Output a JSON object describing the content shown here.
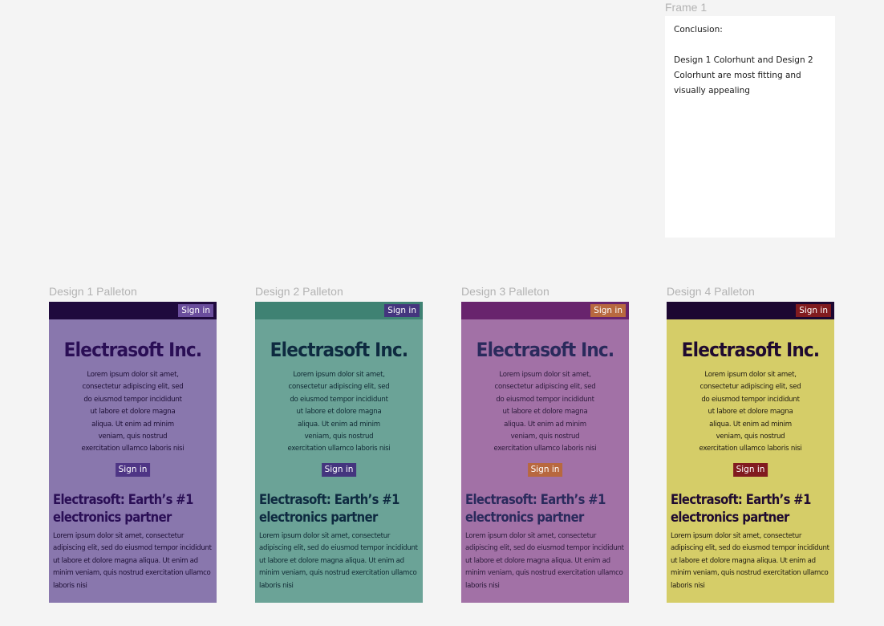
{
  "frame1": {
    "label": "Frame 1",
    "conclusion_heading": "Conclusion:",
    "conclusion_text": "Design 1 Colorhunt and  Design 2 Colorhunt are most fitting and visually appealing"
  },
  "designs": [
    {
      "label": "Design 1 Palleton",
      "topbar_signin": "Sign in",
      "hero_title": "Electrasoft Inc.",
      "hero_body": "Lorem ipsum dolor sit amet, consectetur adipiscing elit, sed do eiusmod tempor incididunt ut labore et dolore magna aliqua. Ut enim ad minim veniam, quis nostrud exercitation ullamco laboris nisi",
      "hero_signin": "Sign in",
      "section_title": "Electrasoft: Earth’s #1 electronics partner",
      "section_body": "Lorem ipsum dolor sit amet, consectetur adipiscing elit, sed do eiusmod tempor incididunt ut labore et dolore magna aliqua. Ut enim ad minim veniam, quis nostrud exercitation ullamco laboris nisi",
      "colors": {
        "background": "#8977ad",
        "topbar": "#1f0a3d",
        "button": "#4e3585",
        "heading": "#2a0e55"
      }
    },
    {
      "label": "Design 2 Palleton",
      "topbar_signin": "Sign in",
      "hero_title": "Electrasoft Inc.",
      "hero_body": "Lorem ipsum dolor sit amet, consectetur adipiscing elit, sed do eiusmod tempor incididunt ut labore et dolore magna aliqua. Ut enim ad minim veniam, quis nostrud exercitation ullamco laboris nisi",
      "hero_signin": "Sign in",
      "section_title": "Electrasoft: Earth’s #1 electronics partner",
      "section_body": "Lorem ipsum dolor sit amet, consectetur adipiscing elit, sed do eiusmod tempor incididunt ut labore et dolore magna aliqua. Ut enim ad minim veniam, quis nostrud exercitation ullamco laboris nisi",
      "colors": {
        "background": "#6ba397",
        "topbar": "#3f8273",
        "button": "#44357e",
        "heading": "#0e2a40"
      }
    },
    {
      "label": "Design 3 Palleton",
      "topbar_signin": "Sign in",
      "hero_title": "Electrasoft Inc.",
      "hero_body": "Lorem ipsum dolor sit amet, consectetur adipiscing elit, sed do eiusmod tempor incididunt ut labore et dolore magna aliqua. Ut enim ad minim veniam, quis nostrud exercitation ullamco laboris nisi",
      "hero_signin": "Sign in",
      "section_title": "Electrasoft: Earth’s #1 electronics partner",
      "section_body": "Lorem ipsum dolor sit amet, consectetur adipiscing elit, sed do eiusmod tempor incididunt ut labore et dolore magna aliqua. Ut enim ad minim veniam, quis nostrud exercitation ullamco laboris nisi",
      "colors": {
        "background": "#a271a6",
        "topbar": "#68246d",
        "button": "#b8683f",
        "heading": "#2a2a5c"
      }
    },
    {
      "label": "Design 4 Palleton",
      "topbar_signin": "Sign in",
      "hero_title": "Electrasoft Inc.",
      "hero_body": "Lorem ipsum dolor sit amet, consectetur adipiscing elit, sed do eiusmod tempor incididunt ut labore et dolore magna aliqua. Ut enim ad minim veniam, quis nostrud exercitation ullamco laboris nisi",
      "hero_signin": "Sign in",
      "section_title": "Electrasoft: Earth’s #1 electronics partner",
      "section_body": "Lorem ipsum dolor sit amet, consectetur adipiscing elit, sed do eiusmod tempor incididunt ut labore et dolore magna aliqua. Ut enim ad minim veniam, quis nostrud exercitation ullamco laboris nisi",
      "colors": {
        "background": "#d5cd68",
        "topbar": "#1c0731",
        "button": "#811b1f",
        "heading": "#1f0a30"
      }
    }
  ]
}
